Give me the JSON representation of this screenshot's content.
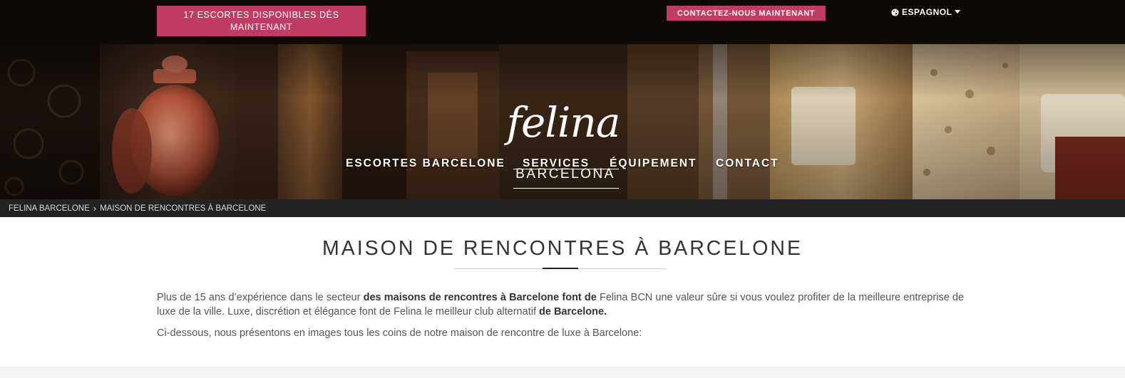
{
  "topbar": {
    "availability": "17 ESCORTES DISPONIBLES DÈS MAINTENANT",
    "contact": "CONTACTEZ-NOUS MAINTENANT",
    "language": "ESPAGNOL"
  },
  "logo": {
    "script": "felina",
    "sub": "BARCELONA"
  },
  "nav": {
    "items": [
      {
        "label": "ESCORTES BARCELONE"
      },
      {
        "label": "SERVICES"
      },
      {
        "label": "ÉQUIPEMENT"
      },
      {
        "label": "CONTACT"
      }
    ]
  },
  "breadcrumb": {
    "home": "FELINA BARCELONE",
    "current": "MAISON DE RENCONTRES À BARCELONE"
  },
  "content": {
    "title": "MAISON DE RENCONTRES À BARCELONE",
    "p1_a": "Plus de 15 ans d’expérience dans le secteur ",
    "p1_b": "des maisons de rencontres à Barcelone font de",
    "p1_c": " Felina BCN une valeur sûre si vous voulez profiter de la meilleure entreprise de luxe de la ville. Luxe, discrétion et élégance font de Felina le meilleur club alternatif ",
    "p1_d": "de Barcelone.",
    "p2": "Ci-dessous, nous présentons en images tous les coins de notre maison de rencontre de luxe à Barcelone:"
  },
  "colors": {
    "accent": "#c23b64",
    "topbar": "#0d0a08",
    "breadcrumb": "#232323"
  },
  "icons": {
    "language": "globe-icon",
    "dropdown": "caret-down-icon",
    "breadcrumb_separator": "chevron-right-icon"
  }
}
